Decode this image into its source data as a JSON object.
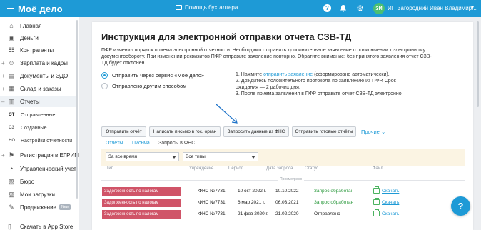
{
  "topbar": {
    "logo": "Моё дело",
    "assistant": "Помощь бухгалтера",
    "avatar_initials": "ЗИ",
    "user_name": "ИП Загородний Иван Владимир...",
    "brand_color": "#1e9ad6"
  },
  "sidebar": {
    "items": [
      {
        "label": "Главная",
        "icon": "home-icon"
      },
      {
        "label": "Деньги",
        "icon": "money-icon"
      },
      {
        "label": "Контрагенты",
        "icon": "contacts-icon"
      },
      {
        "label": "Зарплата и кадры",
        "icon": "salary-icon"
      },
      {
        "label": "Документы и ЭДО",
        "icon": "documents-icon"
      },
      {
        "label": "Склад и заказы",
        "icon": "warehouse-icon"
      },
      {
        "label": "Отчеты",
        "icon": "reports-icon"
      }
    ],
    "sub_items": [
      {
        "code": "ОТ",
        "label": "Отправленные"
      },
      {
        "code": "СЗ",
        "label": "Созданные"
      },
      {
        "code": "НО",
        "label": "Настройки отчетности"
      }
    ],
    "items2": [
      {
        "label": "Регистрация в ЕГРИП",
        "icon": "registration-icon"
      },
      {
        "label": "Управленческий учет",
        "icon": "management-icon"
      },
      {
        "label": "Бюро",
        "icon": "bureau-icon"
      },
      {
        "label": "Мои загрузки",
        "icon": "downloads-icon"
      },
      {
        "label": "Продвижение",
        "icon": "promotion-icon",
        "badge": "New"
      }
    ],
    "store": "Скачать в App Store"
  },
  "main": {
    "title": "Инструкция для электронной отправки отчета СЗВ-ТД",
    "intro": "ПФР изменил порядок приема электронной отчетности. Необходимо отправить дополнительное заявление о подключении к электронному документообороту. При изменении реквизитов ПФР отправьте заявление повторно. Обратите внимание: без принятого заявления отчет СЗВ-ТД будет отклонен.",
    "radio_service": "Отправить через сервис «Мое дело»",
    "radio_other": "Отправлено другим способом",
    "step1_prefix": "1. Нажмите ",
    "step1_link": "отправить заявление",
    "step1_suffix": " (сформировано автоматически).",
    "step2": "2. Дождитесь положительного протокола по заявлению из ПФР. Срок ожидания — 2 рабочих дня.",
    "step3": "3. После приема заявления в ПФР отправьте отчет СЗВ-ТД электронно.",
    "buttons": {
      "send_report": "Отправить отчёт",
      "write_letter": "Написать письмо в гос. орган",
      "request_fns": "Запросить данные из ФНС",
      "send_ready": "Отправить готовые отчёты",
      "more": "Прочие"
    },
    "tabs": [
      "Отчёты",
      "Письма",
      "Запросы в ФНС"
    ],
    "filters": {
      "period": "За все время",
      "type": "Все типы"
    },
    "columns": [
      "Тип",
      "Учреждение",
      "Период",
      "Дата запроса",
      "Статус",
      "Файл"
    ],
    "viewed_label": "Просмотрено",
    "rows": [
      {
        "type": "Задолженность по налогам",
        "org": "ФНС №7731",
        "period": "10 окт 2022 г.",
        "date": "10.10.2022",
        "status": "Запрос обработан",
        "status_ok": true,
        "file": "Скачать"
      },
      {
        "type": "Задолженность по налогам",
        "org": "ФНС №7731",
        "period": "6 мар 2021 г.",
        "date": "06.03.2021",
        "status": "Запрос обработан",
        "status_ok": true,
        "file": "Скачать"
      },
      {
        "type": "Задолженность по налогам",
        "org": "ФНС №7731",
        "period": "21 фев 2020 г.",
        "date": "21.02.2020",
        "status": "Отправлено",
        "status_ok": false,
        "file": "Скачать"
      }
    ]
  },
  "help_fab": "?"
}
